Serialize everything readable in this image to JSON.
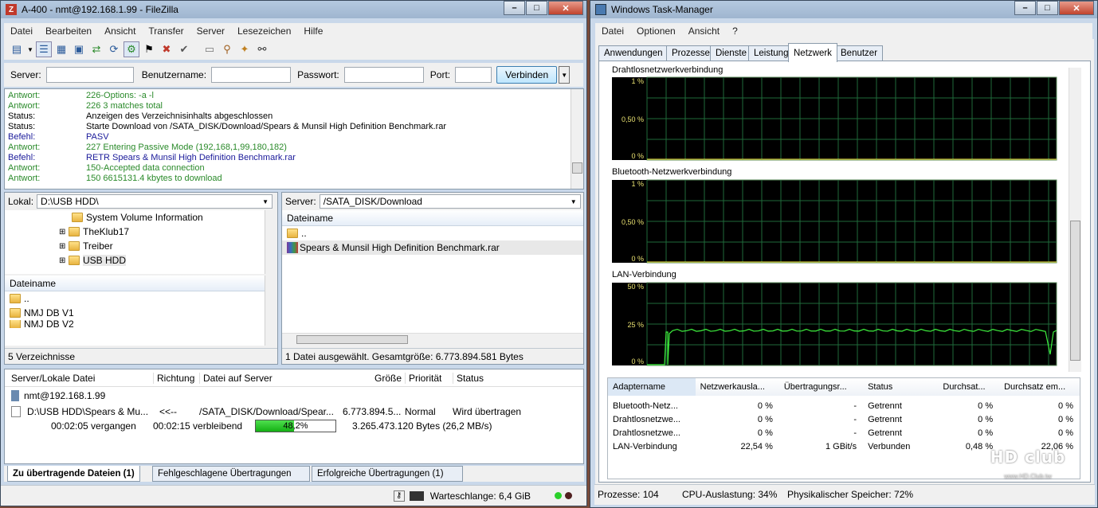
{
  "filezilla": {
    "title": "A-400 - nmt@192.168.1.99 - FileZilla",
    "menu": [
      "Datei",
      "Bearbeiten",
      "Ansicht",
      "Transfer",
      "Server",
      "Lesezeichen",
      "Hilfe"
    ],
    "quickconnect": {
      "server_label": "Server:",
      "user_label": "Benutzername:",
      "pass_label": "Passwort:",
      "port_label": "Port:",
      "connect_button": "Verbinden"
    },
    "log": [
      {
        "k": "Antwort:",
        "v": "226-Options: -a -l",
        "c": "g"
      },
      {
        "k": "Antwort:",
        "v": "226 3 matches total",
        "c": "g"
      },
      {
        "k": "Status:",
        "v": "Anzeigen des Verzeichnisinhalts abgeschlossen",
        "c": ""
      },
      {
        "k": "Status:",
        "v": "Starte Download von /SATA_DISK/Download/Spears & Munsil High Definition Benchmark.rar",
        "c": ""
      },
      {
        "k": "Befehl:",
        "v": "PASV",
        "c": "b"
      },
      {
        "k": "Antwort:",
        "v": "227 Entering Passive Mode (192,168,1,99,180,182)",
        "c": "g"
      },
      {
        "k": "Befehl:",
        "v": "RETR Spears & Munsil High Definition Benchmark.rar",
        "c": "b"
      },
      {
        "k": "Antwort:",
        "v": "150-Accepted data connection",
        "c": "g"
      },
      {
        "k": "Antwort:",
        "v": "150 6615131.4 kbytes to download",
        "c": "g"
      }
    ],
    "local": {
      "label": "Lokal:",
      "path": "D:\\USB HDD\\",
      "tree": [
        "System Volume Information",
        "TheKlub17",
        "Treiber",
        "USB HDD"
      ],
      "col_name": "Dateiname",
      "files": [
        "..",
        "NMJ DB V1",
        "NMJ DB V2"
      ],
      "status": "5 Verzeichnisse"
    },
    "remote": {
      "label": "Server:",
      "path": "/SATA_DISK/Download",
      "col_name": "Dateiname",
      "files": [
        "..",
        "Spears & Munsil High Definition Benchmark.rar"
      ],
      "status": "1 Datei ausgewählt. Gesamtgröße: 6.773.894.581 Bytes"
    },
    "queue": {
      "cols": [
        "Server/Lokale Datei",
        "Richtung",
        "Datei auf Server",
        "Größe",
        "Priorität",
        "Status"
      ],
      "server": "nmt@192.168.1.99",
      "item": {
        "local": "D:\\USB HDD\\Spears & Mu...",
        "dir": "<<--",
        "remote": "/SATA_DISK/Download/Spear...",
        "size": "6.773.894.5...",
        "prio": "Normal",
        "status": "Wird übertragen"
      },
      "elapsed": "00:02:05 vergangen",
      "remaining": "00:02:15 verbleibend",
      "progress": 0.482,
      "progress_label": "48,2%",
      "bytes": "3.265.473.120 Bytes (26,2 MB/s)"
    },
    "tabs": [
      "Zu übertragende Dateien (1)",
      "Fehlgeschlagene Übertragungen",
      "Erfolgreiche Übertragungen (1)"
    ],
    "statusbar": {
      "queue": "Warteschlange: 6,4 GiB"
    }
  },
  "taskmanager": {
    "title": "Windows Task-Manager",
    "menu": [
      "Datei",
      "Optionen",
      "Ansicht",
      "?"
    ],
    "tabs": [
      "Anwendungen",
      "Prozesse",
      "Dienste",
      "Leistung",
      "Netzwerk",
      "Benutzer"
    ],
    "graphs": [
      {
        "name": "Drahtlosnetzwerkverbindung",
        "ticks": [
          "1 %",
          "0,50 %",
          "0 %"
        ]
      },
      {
        "name": "Bluetooth-Netzwerkverbindung",
        "ticks": [
          "1 %",
          "0,50 %",
          "0 %"
        ]
      },
      {
        "name": "LAN-Verbindung",
        "ticks": [
          "50 %",
          "25 %",
          "0 %"
        ]
      }
    ],
    "table": {
      "cols": [
        "Adaptername",
        "Netzwerkausla...",
        "Übertragungsr...",
        "Status",
        "Durchsat...",
        "Durchsatz em..."
      ],
      "rows": [
        [
          "Bluetooth-Netz...",
          "0 %",
          "-",
          "Getrennt",
          "0 %",
          "0 %"
        ],
        [
          "Drahtlosnetzwe...",
          "0 %",
          "-",
          "Getrennt",
          "0 %",
          "0 %"
        ],
        [
          "Drahtlosnetzwe...",
          "0 %",
          "-",
          "Getrennt",
          "0 %",
          "0 %"
        ],
        [
          "LAN-Verbindung",
          "22,54 %",
          "1 GBit/s",
          "Verbunden",
          "0,48 %",
          "22,06 %"
        ]
      ]
    },
    "status": {
      "processes": "Prozesse: 104",
      "cpu": "CPU-Auslastung: 34%",
      "mem": "Physikalischer Speicher: 72%"
    }
  },
  "watermark": {
    "text": "HD club",
    "url": "www.HD.Club.tw"
  }
}
